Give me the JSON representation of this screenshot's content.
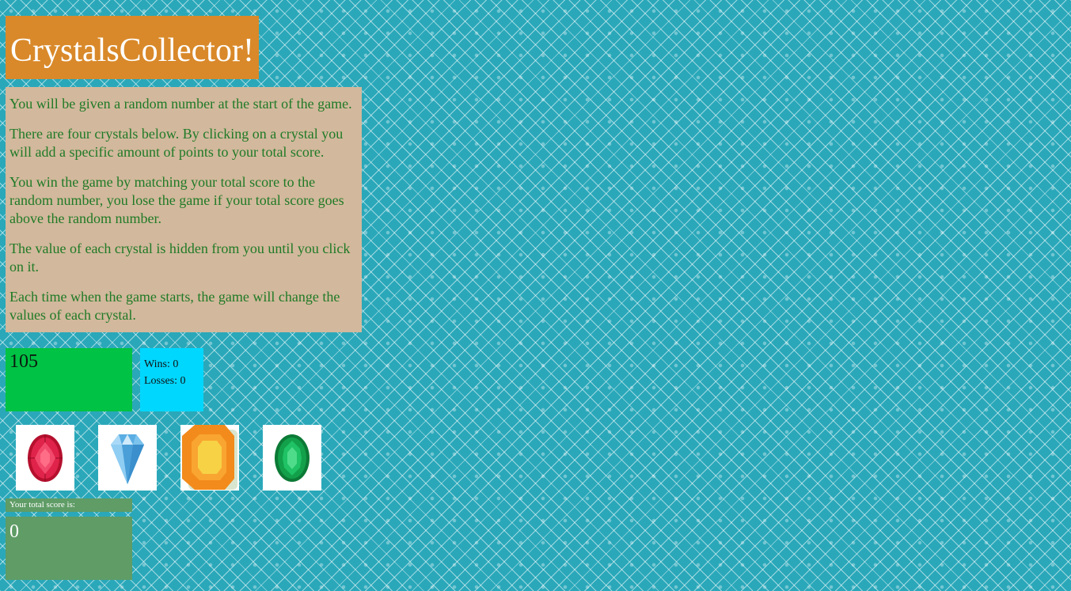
{
  "header": {
    "title": "CrystalsCollector!"
  },
  "instructions": {
    "paragraphs": [
      "You will be given a random number at the start of the game.",
      "There are four crystals below. By clicking on a crystal you will add a specific amount of points to your total score.",
      "You win the game by matching your total score to the random number, you lose the game if your total score goes above the random number.",
      "The value of each crystal is hidden from you until you click on it.",
      "Each time when the game starts, the game will change the values of each crystal."
    ]
  },
  "game": {
    "random_number": "105",
    "wins_label": "Wins: 0",
    "losses_label": "Losses: 0",
    "score_label": "Your total score is:",
    "total_score": "0"
  },
  "crystals": [
    {
      "name": "red-ruby-crystal",
      "icon": "ruby-icon",
      "color": "#d61f45"
    },
    {
      "name": "blue-diamond-crystal",
      "icon": "diamond-icon",
      "color": "#5aaee3"
    },
    {
      "name": "orange-topaz-crystal",
      "icon": "topaz-icon",
      "color": "#f28b1c"
    },
    {
      "name": "green-emerald-crystal",
      "icon": "emerald-icon",
      "color": "#13a04a"
    }
  ],
  "colors": {
    "background": "#2aa8ba",
    "title_bg": "#d9892a",
    "instructions_bg": "#d2b89c",
    "instructions_text": "#1f7a26",
    "target_bg": "#00c244",
    "stats_bg": "#00d7ff",
    "score_bg": "#5f9c66"
  }
}
